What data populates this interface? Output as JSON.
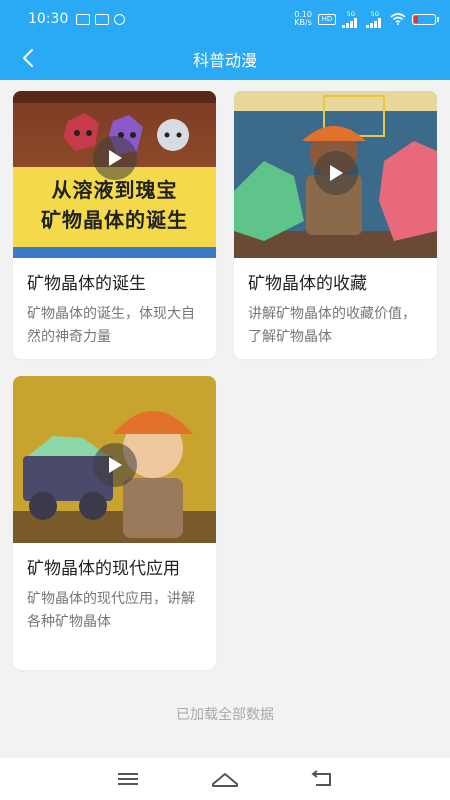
{
  "status_bar": {
    "time": "10:30",
    "net_speed_top": "0.10",
    "net_speed_bottom": "KB/s",
    "network_labels": [
      "HD",
      "5G",
      "5G"
    ],
    "battery_color": "#e33333"
  },
  "header": {
    "title": "科普动漫",
    "back_icon": "chevron-left-icon",
    "background": "#2aa9f4"
  },
  "cards": [
    {
      "title": "矿物晶体的诞生",
      "description": "矿物晶体的诞生，体现大自然的神奇力量",
      "thumbnail_text_line1": "从溶液到瑰宝",
      "thumbnail_text_line2": "矿物晶体的诞生"
    },
    {
      "title": "矿物晶体的收藏",
      "description": "讲解矿物晶体的收藏价值，了解矿物晶体"
    },
    {
      "title": "矿物晶体的现代应用",
      "description": "矿物晶体的现代应用，讲解各种矿物晶体"
    }
  ],
  "load_status": "已加载全部数据",
  "nav": {
    "menu_icon": "menu-icon",
    "home_icon": "home-icon",
    "back_icon": "back-icon"
  }
}
